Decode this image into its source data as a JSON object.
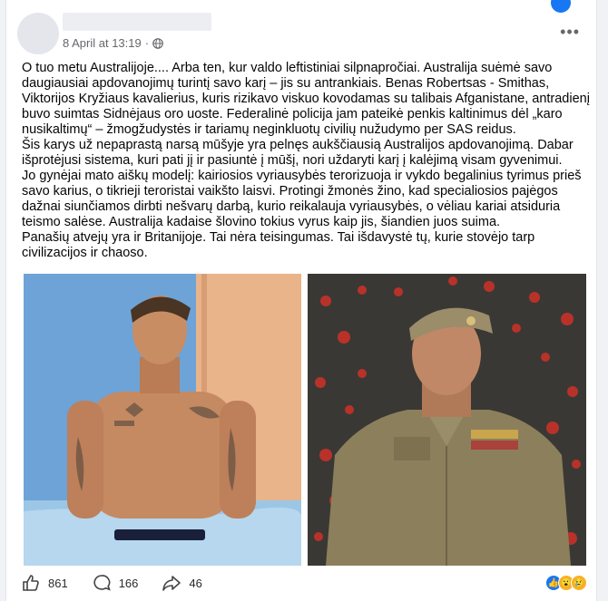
{
  "post": {
    "date": "8 April at 13:19",
    "paragraphs": [
      "O tuo metu Australijoje.... Arba ten, kur valdo leftistiniai silpnapročiai. Australija suėmė savo daugiausiai apdovanojimų turintį savo karį – jis su antrankiais. Benas Robertsas - Smithas, Viktorijos Kryžiaus kavalierius, kuris rizikavo viskuo kovodamas su talibais Afganistane, antradienį buvo suimtas Sidnėjaus oro uoste. Federalinė policija jam pateikė penkis kaltinimus dėl „karo nusikaltimų“ – žmogžudystės ir tariamų neginkluotų civilių nužudymo per SAS reidus.",
      "Šis karys už nepaprastą narsą mūšyje yra pelnęs aukščiausią Australijos apdovanojimą. Dabar išprotėjusi sistema, kuri pati jį ir pasiuntė į mūšį, nori uždaryti karį į kalėjimą visam gyvenimui.",
      "Jo gynėjai mato aiškų modelį: kairiosios vyriausybės terorizuoja ir vykdo begalinius tyrimus prieš savo karius, o tikrieji teroristai vaikšto laisvi. Protingi žmonės žino, kad specialiosios pajėgos dažnai siunčiamos dirbti nešvarų darbą, kurio reikalauja vyriausybės, o vėliau kariai atsiduria teismo salėse. Australija kadaise šlovino tokius vyrus kaip jis, šiandien juos suima.",
      "Panašių atvejų yra ir Britanijoje. Tai nėra teisingumas. Tai išdavystė tų, kurie stovėjo tarp civilizacijos ir chaoso."
    ]
  },
  "footer": {
    "likes": "861",
    "comments": "166",
    "shares": "46"
  },
  "colors": {
    "brand": "#1877f2",
    "secondary_text": "#65676b"
  },
  "icons": [
    "globe-icon",
    "more-icon",
    "like-icon",
    "comment-icon",
    "share-icon"
  ]
}
